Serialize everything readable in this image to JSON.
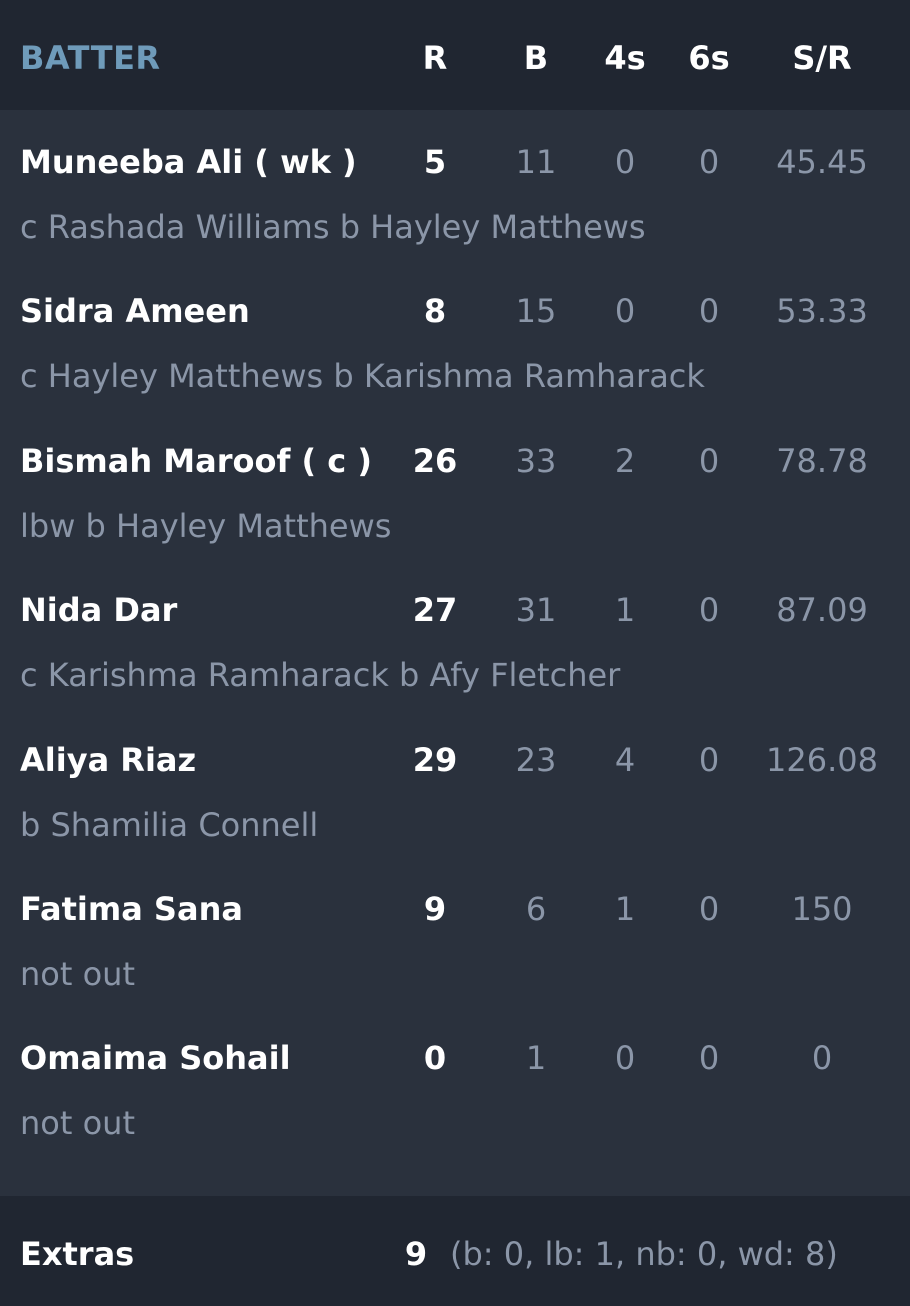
{
  "header": {
    "batter": "BATTER",
    "runs": "R",
    "balls": "B",
    "fours": "4s",
    "sixes": "6s",
    "strike_rate": "S/R"
  },
  "batters": [
    {
      "name": "Muneeba Ali ( wk )",
      "runs": "5",
      "balls": "11",
      "fours": "0",
      "sixes": "0",
      "sr": "45.45",
      "dismissal": "c Rashada Williams b Hayley Matthews"
    },
    {
      "name": "Sidra Ameen",
      "runs": "8",
      "balls": "15",
      "fours": "0",
      "sixes": "0",
      "sr": "53.33",
      "dismissal": "c Hayley Matthews b Karishma Ramharack"
    },
    {
      "name": "Bismah Maroof ( c )",
      "runs": "26",
      "balls": "33",
      "fours": "2",
      "sixes": "0",
      "sr": "78.78",
      "dismissal": "lbw b Hayley Matthews"
    },
    {
      "name": "Nida Dar",
      "runs": "27",
      "balls": "31",
      "fours": "1",
      "sixes": "0",
      "sr": "87.09",
      "dismissal": "c Karishma Ramharack b Afy Fletcher"
    },
    {
      "name": "Aliya Riaz",
      "runs": "29",
      "balls": "23",
      "fours": "4",
      "sixes": "0",
      "sr": "126.08",
      "dismissal": "b Shamilia Connell"
    },
    {
      "name": "Fatima Sana",
      "runs": "9",
      "balls": "6",
      "fours": "1",
      "sixes": "0",
      "sr": "150",
      "dismissal": "not out"
    },
    {
      "name": "Omaima Sohail",
      "runs": "0",
      "balls": "1",
      "fours": "0",
      "sixes": "0",
      "sr": "0",
      "dismissal": "not out"
    }
  ],
  "extras": {
    "label": "Extras",
    "total": "9",
    "breakdown": "(b: 0, lb: 1, nb: 0, wd: 8)"
  },
  "colors": {
    "background": "#2a313d",
    "header_background": "#202631",
    "accent": "#6f9bba",
    "primary_text": "#ffffff",
    "secondary_text": "#8b96a8"
  }
}
